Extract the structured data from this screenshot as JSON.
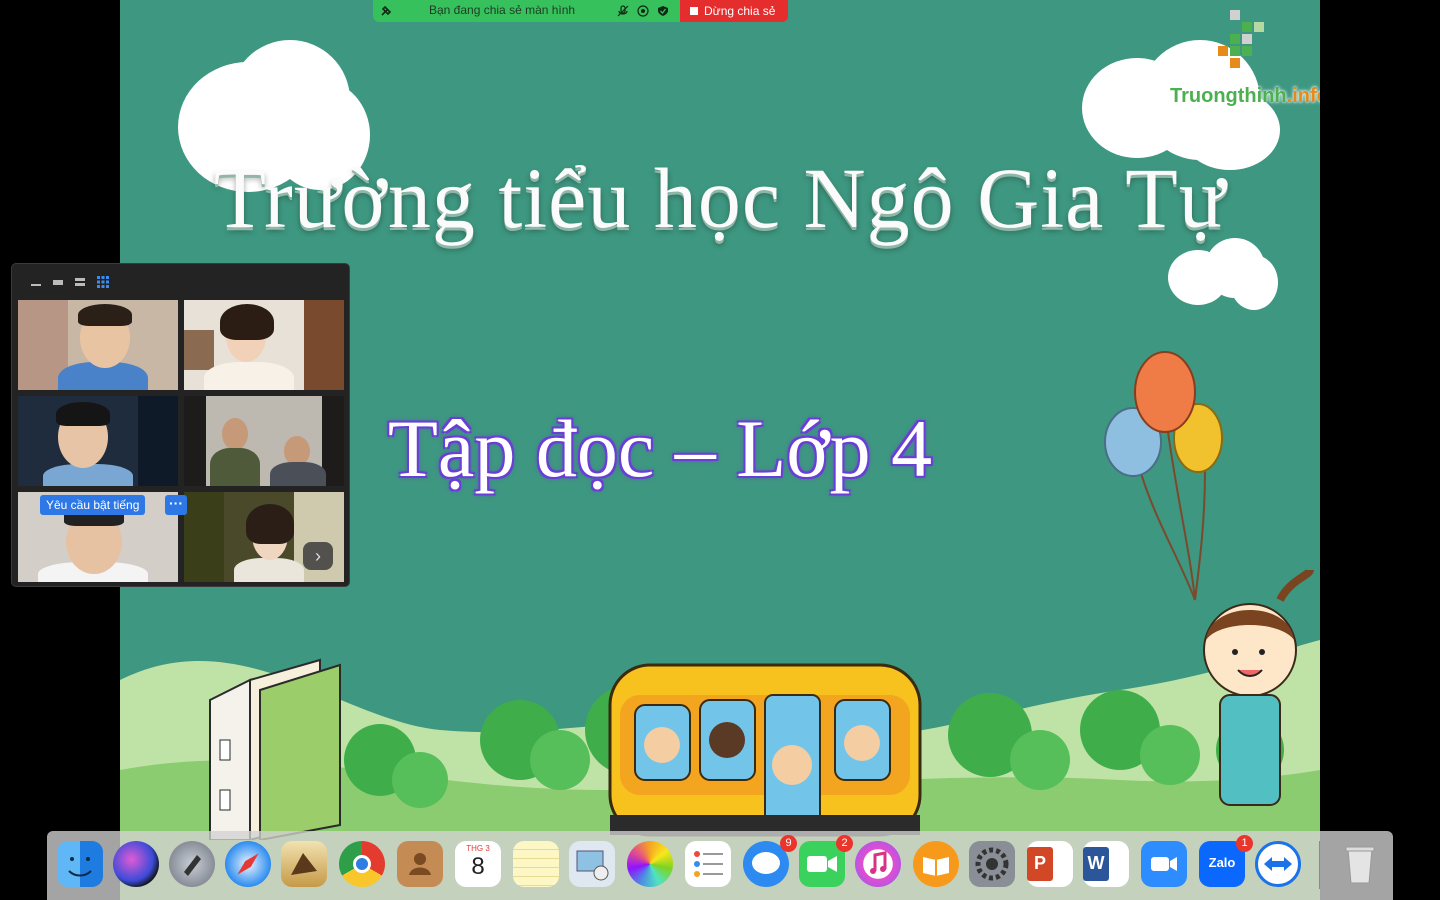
{
  "share_bar": {
    "status_text": "Bạn đang chia sẻ màn hình",
    "stop_label": "Dừng chia sẻ"
  },
  "slide": {
    "title": "Trường tiểu học Ngô Gia Tự",
    "subtitle": "Tập đọc – Lớp 4",
    "logo_main": "Truongthinh",
    "logo_tail": ".info"
  },
  "gallery": {
    "unmute_request": "Yêu cầu bật tiếng",
    "more_label": "···",
    "next_label": "›"
  },
  "dock": {
    "calendar_month": "THG 3",
    "calendar_day": "8",
    "messages_badge": "9",
    "facetime_badge": "2",
    "zalo_badge": "1",
    "zalo_label": "Zalo",
    "word_label": "W",
    "ppt_label": "P"
  },
  "colors": {
    "slide_bg": "#3e9780",
    "share_green": "#37c15c",
    "share_red": "#e52d2d",
    "zoom_blue": "#2d78e6"
  }
}
